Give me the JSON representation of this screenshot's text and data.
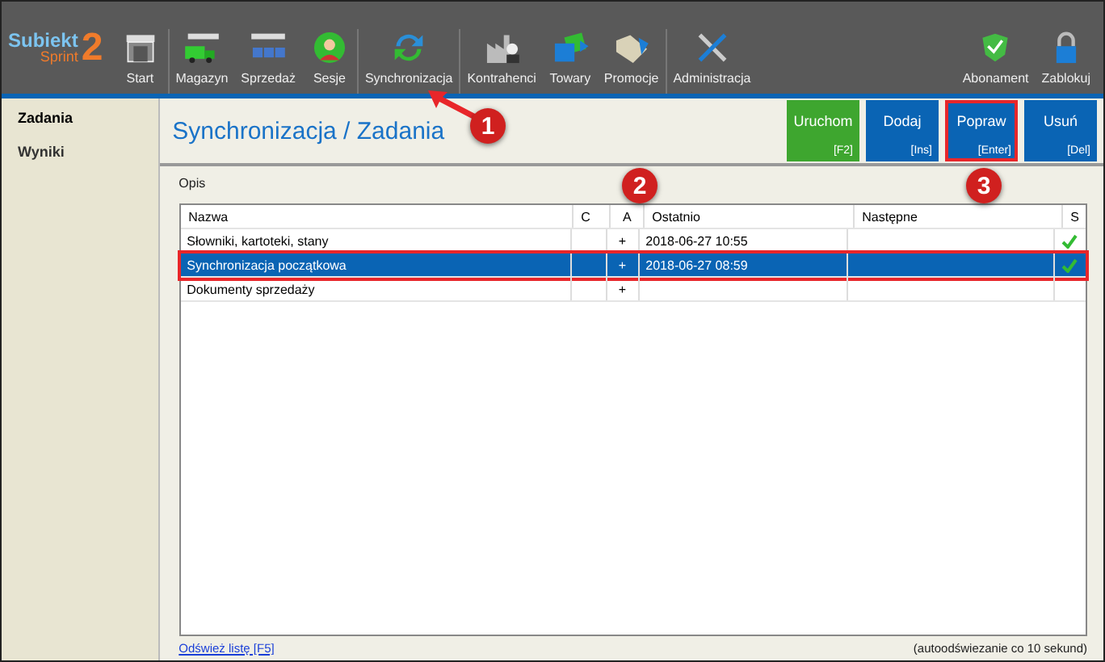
{
  "logo": {
    "name": "Subiekt",
    "sub": "Sprint",
    "num": "2"
  },
  "toolbar": [
    {
      "label": "Start"
    },
    {
      "label": "Magazyn"
    },
    {
      "label": "Sprzedaż"
    },
    {
      "label": "Sesje"
    },
    {
      "label": "Synchronizacja"
    },
    {
      "label": "Kontrahenci"
    },
    {
      "label": "Towary"
    },
    {
      "label": "Promocje"
    },
    {
      "label": "Administracja"
    }
  ],
  "toolbar_right": [
    {
      "label": "Abonament"
    },
    {
      "label": "Zablokuj"
    }
  ],
  "sidebar": {
    "items": [
      {
        "label": "Zadania",
        "selected": true
      },
      {
        "label": "Wyniki",
        "selected": false
      }
    ]
  },
  "title": "Synchronizacja / Zadania",
  "actions": [
    {
      "label": "Uruchom",
      "key": "[F2]",
      "color": "#3ea62f",
      "highlighted": false
    },
    {
      "label": "Dodaj",
      "key": "[Ins]",
      "color": "#0a64b4",
      "highlighted": false
    },
    {
      "label": "Popraw",
      "key": "[Enter]",
      "color": "#0a64b4",
      "highlighted": true
    },
    {
      "label": "Usuń",
      "key": "[Del]",
      "color": "#0a64b4",
      "highlighted": false
    }
  ],
  "section_label": "Opis",
  "table": {
    "columns": [
      "Nazwa",
      "C",
      "A",
      "Ostatnio",
      "Następne",
      "S"
    ],
    "rows": [
      {
        "cells": [
          "Słowniki, kartoteki, stany",
          "",
          "+",
          "2018-06-27 10:55",
          ""
        ],
        "ok": true,
        "selected": false,
        "highlighted": false
      },
      {
        "cells": [
          "Synchronizacja początkowa",
          "",
          "+",
          "2018-06-27 08:59",
          ""
        ],
        "ok": true,
        "selected": true,
        "highlighted": true
      },
      {
        "cells": [
          "Dokumenty sprzedaży",
          "",
          "+",
          "",
          ""
        ],
        "ok": false,
        "selected": false,
        "highlighted": false
      }
    ]
  },
  "refresh_link": "Odśwież listę [F5]",
  "auto_note": "(autoodświezanie co 10 sekund)",
  "callouts": [
    "1",
    "2",
    "3"
  ]
}
